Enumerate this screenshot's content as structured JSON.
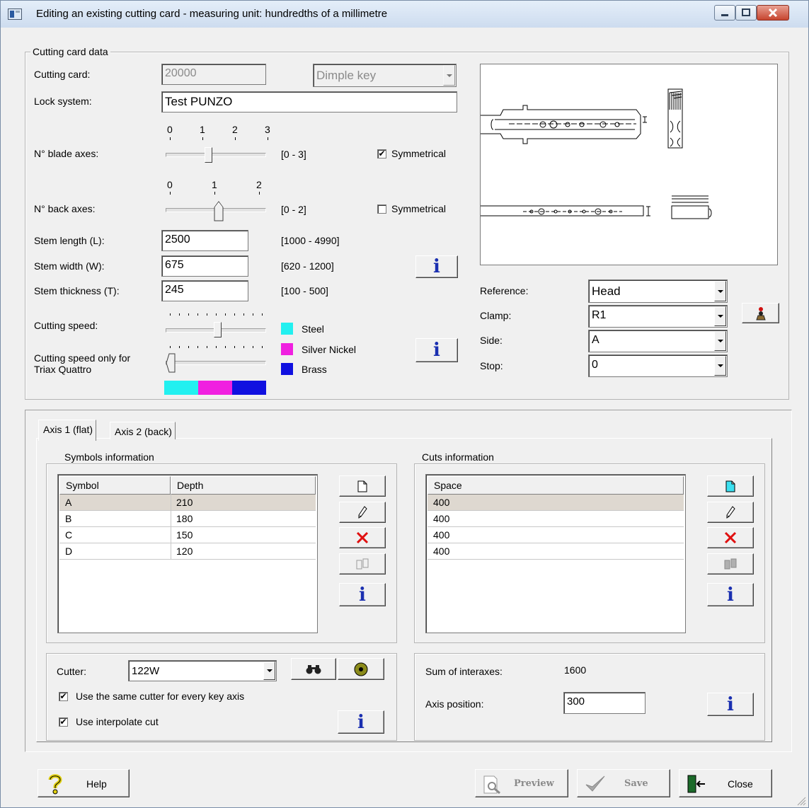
{
  "window": {
    "title": "Editing an existing cutting card - measuring unit: hundredths of a millimetre"
  },
  "card": {
    "group_label": "Cutting card data",
    "cutting_card_label": "Cutting card:",
    "cutting_card_value": "20000",
    "key_type": "Dimple key",
    "lock_system_label": "Lock system:",
    "lock_system_value": "Test PUNZO",
    "blade_axes_label": "N° blade axes:",
    "blade_ticks": [
      "0",
      "1",
      "2",
      "3"
    ],
    "blade_axes_value": 1,
    "blade_range": "[0 - 3]",
    "blade_symmetrical": "Symmetrical",
    "blade_symmetrical_checked": true,
    "back_axes_label": "N° back axes:",
    "back_ticks": [
      "0",
      "1",
      "2"
    ],
    "back_axes_value": 1,
    "back_range": "[0 - 2]",
    "back_symmetrical": "Symmetrical",
    "back_symmetrical_checked": false,
    "stem_length_label": "Stem length (L):",
    "stem_length_value": "2500",
    "stem_length_range": "[1000 - 4990]",
    "stem_width_label": "Stem width (W):",
    "stem_width_value": "675",
    "stem_width_range": "[620 - 1200]",
    "stem_thickness_label": "Stem thickness (T):",
    "stem_thickness_value": "245",
    "stem_thickness_range": "[100 - 500]",
    "cutting_speed_label": "Cutting speed:",
    "cutting_speed_triax_label_1": "Cutting speed only for",
    "cutting_speed_triax_label_2": "Triax Quattro",
    "materials": [
      {
        "name": "Steel",
        "color": "#22f0f0"
      },
      {
        "name": "Silver Nickel",
        "color": "#f020e0"
      },
      {
        "name": "Brass",
        "color": "#1010e0"
      }
    ]
  },
  "settings": {
    "reference_label": "Reference:",
    "reference_value": "Head",
    "clamp_label": "Clamp:",
    "clamp_value": "R1",
    "side_label": "Side:",
    "side_value": "A",
    "stop_label": "Stop:",
    "stop_value": "0"
  },
  "tabs": [
    {
      "label": "Axis 1 (flat)"
    },
    {
      "label": "Axis 2 (back)"
    }
  ],
  "symbols": {
    "group_label": "Symbols information",
    "col_symbol": "Symbol",
    "col_depth": "Depth",
    "rows": [
      {
        "symbol": "A",
        "depth": "210"
      },
      {
        "symbol": "B",
        "depth": "180"
      },
      {
        "symbol": "C",
        "depth": "150"
      },
      {
        "symbol": "D",
        "depth": "120"
      }
    ]
  },
  "cuts": {
    "group_label": "Cuts information",
    "col_space": "Space",
    "rows": [
      {
        "space": "400"
      },
      {
        "space": "400"
      },
      {
        "space": "400"
      },
      {
        "space": "400"
      }
    ]
  },
  "cutter": {
    "label": "Cutter:",
    "value": "122W",
    "same_cutter_label": "Use the same cutter for every key axis",
    "same_cutter_checked": true,
    "interpolate_label": "Use interpolate cut",
    "interpolate_checked": true
  },
  "axis": {
    "sum_label": "Sum of interaxes:",
    "sum_value": "1600",
    "position_label": "Axis position:",
    "position_value": "300"
  },
  "footer": {
    "help": "Help",
    "preview": "Preview",
    "save": "Save",
    "close": "Close"
  },
  "info_glyph": "i"
}
